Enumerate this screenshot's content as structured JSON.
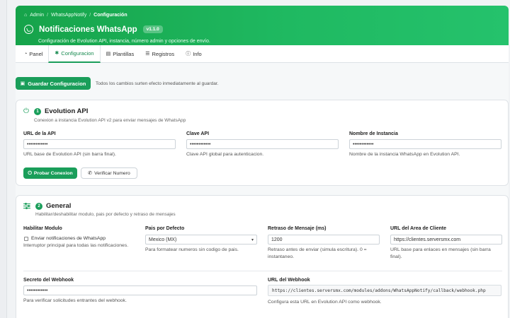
{
  "breadcrumb": {
    "home": "Admin",
    "parent": "WhatsAppNotify",
    "current": "Configuración"
  },
  "header": {
    "title": "Notificaciones WhatsApp",
    "version": "v1.1.0",
    "subtitle": "Configuración de Evolution API, instancia, número admin y opciones de envío.",
    "colors": {
      "gradient_start": "#16a34a",
      "gradient_end": "#25c26c"
    }
  },
  "tabs": [
    {
      "label": "Panel",
      "icon": "dashboard-icon",
      "active": false
    },
    {
      "label": "Configuracion",
      "icon": "gear-icon",
      "active": true
    },
    {
      "label": "Plantillas",
      "icon": "file-icon",
      "active": false
    },
    {
      "label": "Registros",
      "icon": "list-icon",
      "active": false
    },
    {
      "label": "Info",
      "icon": "info-icon",
      "active": false
    }
  ],
  "toolbar": {
    "save_label": "Guardar Configuracion",
    "save_note": "Todos los cambios surten efecto inmediatamente al guardar."
  },
  "evolution": {
    "step": "1",
    "title": "Evolution API",
    "description": "Conexion a instancia Evolution API v2 para enviar mensajes de WhatsApp",
    "api_url": {
      "label": "URL de la API",
      "value": "••••••••••••",
      "help": "URL base de Evolution API (sin barra final)."
    },
    "api_key": {
      "label": "Clave API",
      "value": "••••••••••••",
      "help": "Clave API global para autenticacion."
    },
    "instance": {
      "label": "Nombre de Instancia",
      "value": "••••••••••••",
      "help": "Nombre de la instancia WhatsApp en Evolution API."
    },
    "test_label": "Probar Conexion",
    "verify_label": "Verificar Numero"
  },
  "general": {
    "step": "2",
    "title": "General",
    "description": "Habilitar/deshabilitar modulo, pais por defecto y retraso de mensajes",
    "enable": {
      "label": "Habilitar Modulo",
      "checkbox_label": "Enviar notificaciones de WhatsApp",
      "checked": false,
      "help": "Interruptor principal para todas las notificaciones."
    },
    "country": {
      "label": "Pais por Defecto",
      "selected": "Mexico (MX)",
      "help": "Para formatear numeros sin codigo de pais."
    },
    "delay": {
      "label": "Retraso de Mensaje (ms)",
      "value": "1200",
      "help": "Retraso antes de enviar (simula escritura). 0 = instantaneo."
    },
    "client_url": {
      "label": "URL del Area de Cliente",
      "value": "https://clientes.serversmx.com",
      "help": "URL base para enlaces en mensajes (sin barra final)."
    },
    "webhook_secret": {
      "label": "Secreto del Webhook",
      "value": "••••••••••••",
      "help": "Para verificar solicitudes entrantes del webhook."
    },
    "webhook_url": {
      "label": "URL del Webhook",
      "value": "https://clientes.serversmx.com/modules/addons/WhatsAppNotify/callback/webhook.php",
      "help": "Configura esta URL en Evolution API como webhook."
    }
  }
}
